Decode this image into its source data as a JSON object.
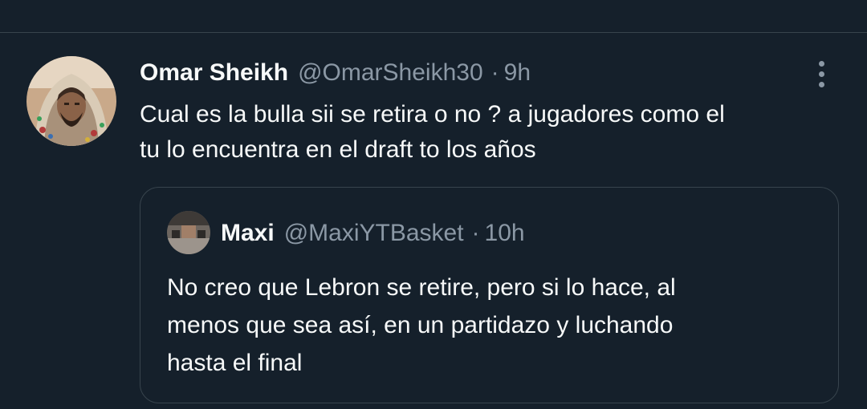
{
  "tweet": {
    "author_name": "Omar Sheikh",
    "author_handle": "@OmarSheikh30",
    "separator": "·",
    "time": "9h",
    "text_lines": [
      "Cual es la bulla sii se retira o no ? a jugadores como el",
      "tu lo encuentra en el draft to los años"
    ],
    "more_icon": "more-vertical-icon"
  },
  "quoted_tweet": {
    "author_name": "Maxi",
    "author_handle": "@MaxiYTBasket",
    "separator": "·",
    "time": "10h",
    "text_lines": [
      "No creo que Lebron se retire, pero si lo hace, al",
      "menos que sea así, en un partidazo y luchando",
      "hasta el final"
    ]
  },
  "colors": {
    "background": "#15202b",
    "primary_text": "#f7f9f9",
    "secondary_text": "#8b98a5",
    "border": "#38444d"
  }
}
